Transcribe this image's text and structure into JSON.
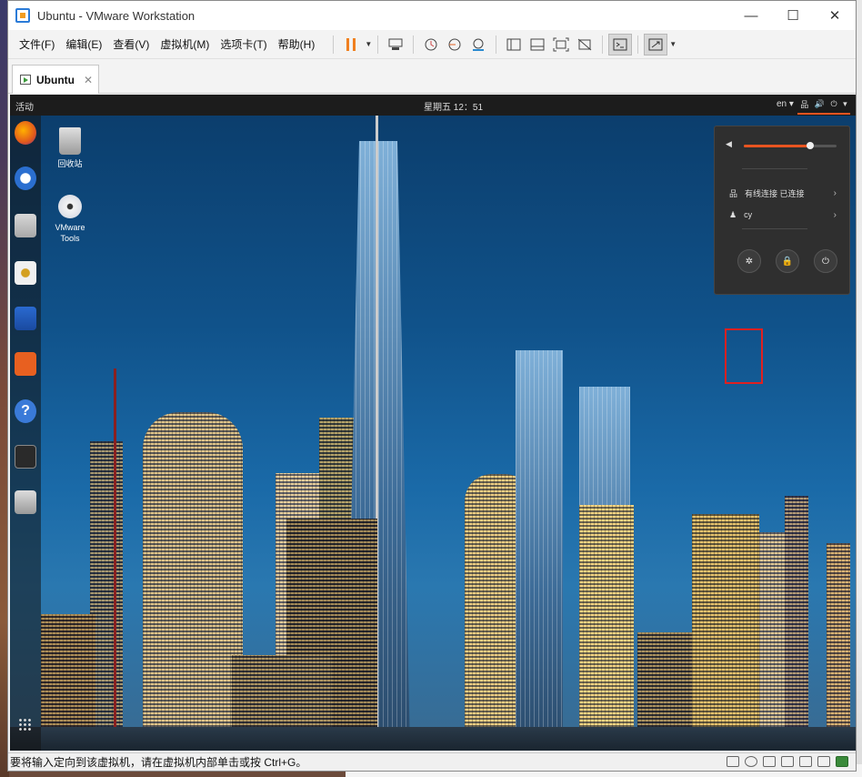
{
  "window": {
    "title": "Ubuntu - VMware Workstation"
  },
  "menu": [
    "文件(F)",
    "编辑(E)",
    "查看(V)",
    "虚拟机(M)",
    "选项卡(T)",
    "帮助(H)"
  ],
  "tab": {
    "label": "Ubuntu"
  },
  "guest": {
    "activities": "活动",
    "clock": "星期五 12：51",
    "lang": "en ▾",
    "desktop_icons": [
      "回收站",
      "VMware Tools"
    ],
    "dock_apps": [
      "firefox",
      "thunderbird",
      "files",
      "rhythmbox",
      "writer",
      "software",
      "help",
      "terminal",
      "dvd"
    ]
  },
  "sysmenu": {
    "volume": 0.72,
    "wired": "有线连接 已连接",
    "user": "cy",
    "buttons": [
      "settings-icon",
      "lock-icon",
      "power-icon"
    ]
  },
  "status": {
    "message": "要将输入定向到该虚拟机，请在虚拟机内部单击或按 Ctrl+G。"
  },
  "colors": {
    "ubuntu_orange": "#e95420",
    "highlight": "#e02020"
  }
}
